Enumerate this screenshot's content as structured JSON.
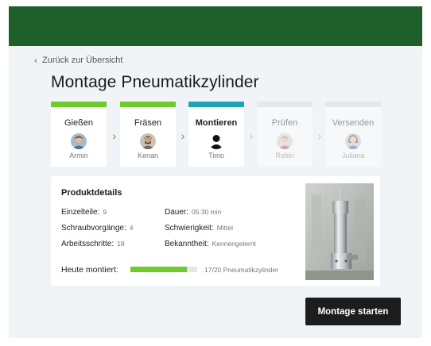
{
  "nav": {
    "back_label": "Zurück zur Übersicht"
  },
  "page": {
    "title": "Montage Pneumatikzylinder"
  },
  "steps": [
    {
      "label": "Gießen",
      "person": "Armin",
      "status": "done",
      "bar_color": "#6fcb2b",
      "avatar": "avatar-photo-icon"
    },
    {
      "label": "Fräsen",
      "person": "Kenan",
      "status": "done",
      "bar_color": "#6fcb2b",
      "avatar": "avatar-photo-icon"
    },
    {
      "label": "Montieren",
      "person": "Timo",
      "status": "active",
      "bar_color": "#1fa3b3",
      "avatar": "user-silhouette-icon"
    },
    {
      "label": "Prüfen",
      "person": "Robin",
      "status": "pending",
      "bar_color": "#d6dadd",
      "avatar": "avatar-photo-icon"
    },
    {
      "label": "Versenden",
      "person": "Juliana",
      "status": "pending",
      "bar_color": "#d6dadd",
      "avatar": "avatar-photo-icon"
    }
  ],
  "details": {
    "heading": "Produktdetails",
    "left": [
      {
        "key": "Einzelteile:",
        "value": "9"
      },
      {
        "key": "Schraubvorgänge:",
        "value": "4"
      },
      {
        "key": "Arbeitsschritte:",
        "value": "18"
      }
    ],
    "right": [
      {
        "key": "Dauer:",
        "value": "05:30 min"
      },
      {
        "key": "Schwierigkeit:",
        "value": "Mittel"
      },
      {
        "key": "Bekanntheit:",
        "value": "Kennengelernt"
      }
    ],
    "progress": {
      "label": "Heute montiert:",
      "text": "17/20 Pneumatikzylinder",
      "fraction": 0.85,
      "color": "#6fcb2b"
    }
  },
  "actions": {
    "start_label": "Montage starten"
  }
}
